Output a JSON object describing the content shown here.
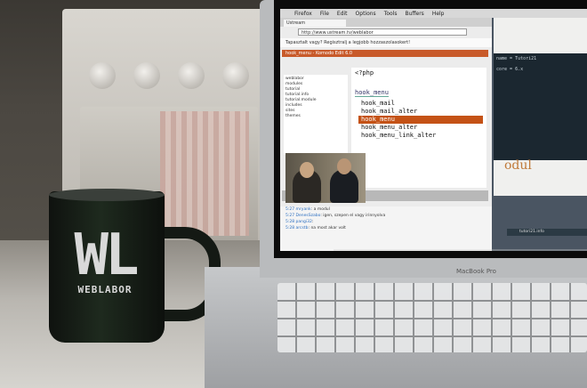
{
  "mug": {
    "logo_big": "WL",
    "logo_small": "WEBLABOR"
  },
  "laptop": {
    "brand": "MacBook Pro"
  },
  "mac_menubar": [
    "Firefox",
    "File",
    "Edit",
    "Options",
    "Tools",
    "Buffers",
    "Help"
  ],
  "browser": {
    "tab_title": "Ustream",
    "url": "http://www.ustream.tv/weblabor",
    "notice": "Tapasztalt vagy? Regisztralj a legjobb hozzaszolasokert!"
  },
  "ide": {
    "title": "hook_menu - Komodo Edit 6.0",
    "file_tree": [
      "weblabor",
      "modules",
      "tutorial",
      "tutorial.info",
      "tutorial.module",
      "includes",
      "sites",
      "themes"
    ],
    "code": [
      "<?php",
      "",
      "hook_menu"
    ],
    "autocomplete": [
      "hook_mail",
      "hook_mail_alter",
      "hook_menu",
      "hook_menu_alter",
      "hook_menu_link_alter"
    ],
    "selected_index": 2
  },
  "stream": {
    "viewers": "46 viewers"
  },
  "chat": [
    {
      "time": "5:27",
      "user": "mryank",
      "text": "a modul"
    },
    {
      "time": "5:27",
      "user": "DenesSzabo",
      "text": "igen, szepen el vagy irinnyolva"
    },
    {
      "time": "5:28",
      "user": "pangi32",
      "text": ""
    },
    {
      "time": "5:28",
      "user": "arcstb",
      "text": "na most akar volt"
    }
  ],
  "right_panel": {
    "editor_lines": [
      "name = Tutori21",
      "core = 6.x"
    ],
    "title_fragment": "odul",
    "statusline": "tutori21.info"
  },
  "colors": {
    "highlight": "#c45216",
    "ide_bar": "#c85a2a"
  }
}
